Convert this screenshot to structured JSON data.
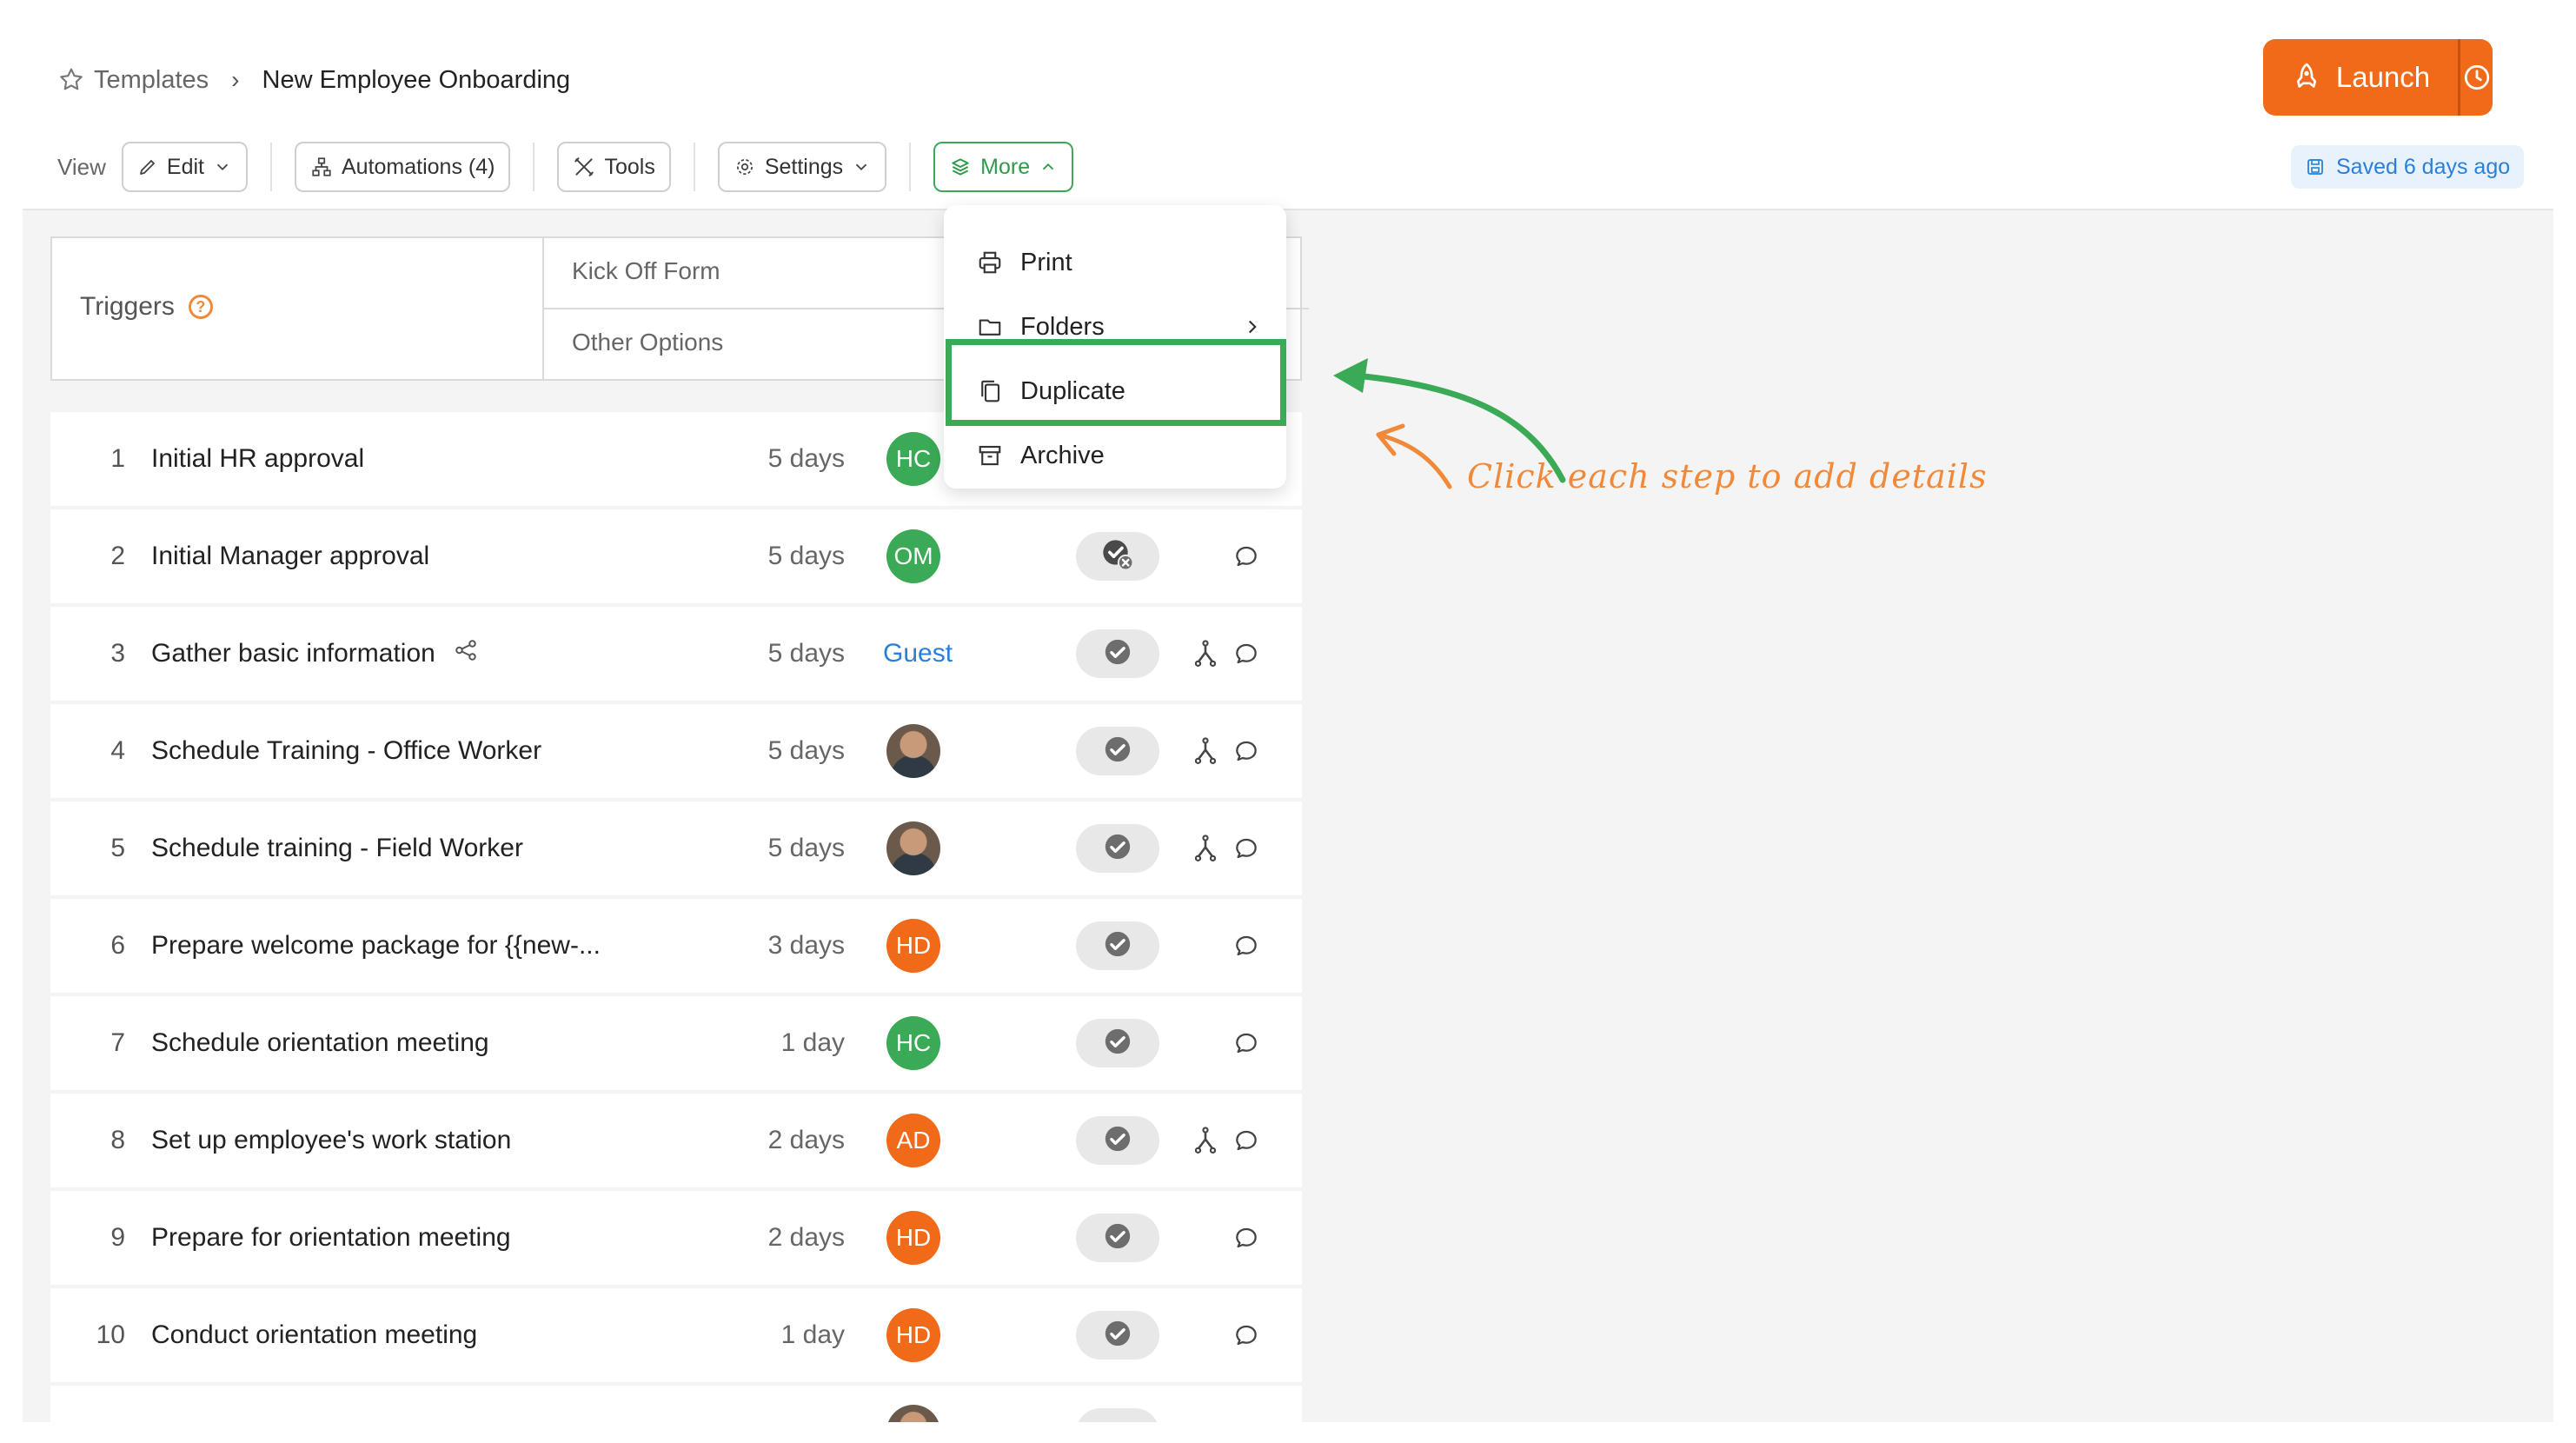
{
  "breadcrumb": {
    "templates": "Templates",
    "separator": "›",
    "current": "New Employee Onboarding"
  },
  "launch": {
    "label": "Launch"
  },
  "toolbar": {
    "view_label": "View",
    "edit_label": "Edit",
    "automations_label": "Automations (4)",
    "tools_label": "Tools",
    "settings_label": "Settings",
    "more_label": "More",
    "saved_label": "Saved 6 days ago"
  },
  "triggers": {
    "label": "Triggers",
    "help": "?",
    "kickoff": "Kick Off Form",
    "other": "Other Options"
  },
  "menu": {
    "print": "Print",
    "folders": "Folders",
    "duplicate": "Duplicate",
    "archive": "Archive"
  },
  "annotation": "Click each step to add details",
  "steps": [
    {
      "num": "1",
      "name": "Initial HR approval",
      "duration": "5 days",
      "assignee": "HC",
      "assignee_color": "#3aaa56"
    },
    {
      "num": "2",
      "name": "Initial Manager approval",
      "duration": "5 days",
      "assignee": "OM",
      "assignee_color": "#3aaa56"
    },
    {
      "num": "3",
      "name": "Gather basic information",
      "duration": "5 days",
      "assignee": "Guest"
    },
    {
      "num": "4",
      "name": "Schedule Training - Office Worker",
      "duration": "5 days",
      "assignee": "photo"
    },
    {
      "num": "5",
      "name": "Schedule training - Field Worker",
      "duration": "5 days",
      "assignee": "photo"
    },
    {
      "num": "6",
      "name": "Prepare welcome package for {{new-...",
      "duration": "3 days",
      "assignee": "HD",
      "assignee_color": "#f06a1a"
    },
    {
      "num": "7",
      "name": "Schedule orientation meeting",
      "duration": "1 day",
      "assignee": "HC",
      "assignee_color": "#3aaa56"
    },
    {
      "num": "8",
      "name": "Set up employee's work station",
      "duration": "2 days",
      "assignee": "AD",
      "assignee_color": "#f06a1a"
    },
    {
      "num": "9",
      "name": "Prepare for orientation meeting",
      "duration": "2 days",
      "assignee": "HD",
      "assignee_color": "#f06a1a"
    },
    {
      "num": "10",
      "name": "Conduct orientation meeting",
      "duration": "1 day",
      "assignee": "HD",
      "assignee_color": "#f06a1a"
    }
  ]
}
